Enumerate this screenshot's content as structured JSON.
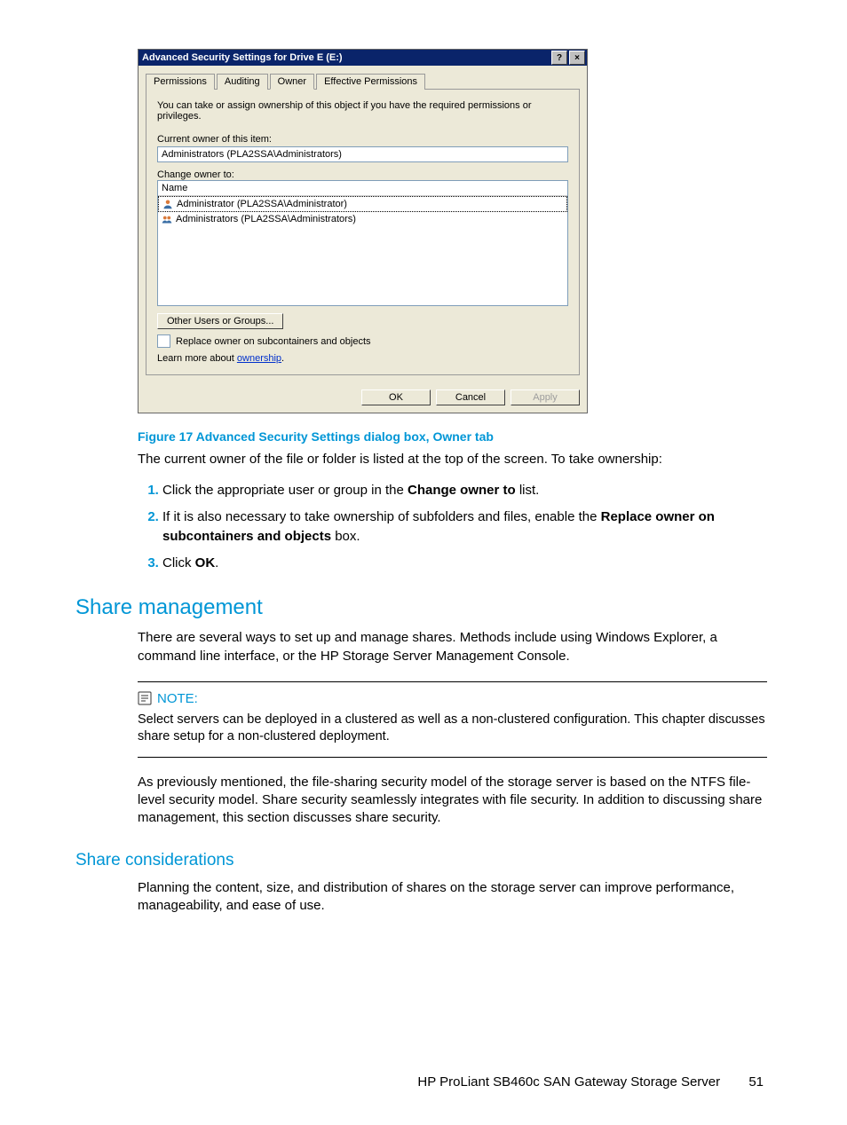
{
  "dialog": {
    "title": "Advanced Security Settings for Drive E (E:)",
    "tabs": [
      "Permissions",
      "Auditing",
      "Owner",
      "Effective Permissions"
    ],
    "active_tab": 2,
    "intro": "You can take or assign ownership of this object if you have the required permissions or privileges.",
    "current_owner_label": "Current owner of this item:",
    "current_owner_value": "Administrators (PLA2SSA\\Administrators)",
    "change_owner_label": "Change owner to:",
    "list_header": "Name",
    "owners": [
      "Administrator (PLA2SSA\\Administrator)",
      "Administrators (PLA2SSA\\Administrators)"
    ],
    "other_users_btn": "Other Users or Groups...",
    "replace_label": "Replace owner on subcontainers and objects",
    "learn_more_pre": "Learn more about ",
    "learn_more_link": "ownership",
    "buttons": {
      "ok": "OK",
      "cancel": "Cancel",
      "apply": "Apply"
    }
  },
  "figure_caption": "Figure 17 Advanced Security Settings dialog box, Owner tab",
  "owner_intro": "The current owner of the file or folder is listed at the top of the screen. To take ownership:",
  "steps": {
    "s1_pre": "Click the appropriate user or group in the ",
    "s1_bold": "Change owner to",
    "s1_post": " list.",
    "s2_pre": "If it is also necessary to take ownership of subfolders and files, enable the ",
    "s2_bold": "Replace owner on subcontainers and objects",
    "s2_post": " box.",
    "s3_pre": "Click ",
    "s3_bold": "OK",
    "s3_post": "."
  },
  "share_mgmt": {
    "heading": "Share management",
    "p1": "There are several ways to set up and manage shares. Methods include using Windows Explorer, a command line interface, or the HP Storage Server Management Console.",
    "note_label": "NOTE:",
    "note_body": "Select servers can be deployed in a clustered as well as a non-clustered configuration. This chapter discusses share setup for a non-clustered deployment.",
    "p2": "As previously mentioned, the file-sharing security model of the storage server is based on the NTFS file-level security model. Share security seamlessly integrates with file security. In addition to discussing share management, this section discusses share security."
  },
  "share_cons": {
    "heading": "Share considerations",
    "p1": "Planning the content, size, and distribution of shares on the storage server can improve performance, manageability, and ease of use."
  },
  "footer": {
    "doc": "HP ProLiant SB460c SAN Gateway Storage Server",
    "page": "51"
  }
}
